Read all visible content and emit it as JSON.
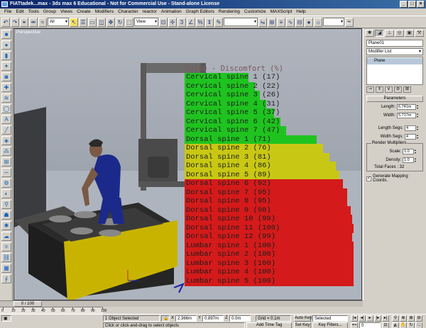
{
  "window": {
    "title": "FIATtadek...max - 3ds max 6 Educational - Not for Commercial Use - Stand-alone License",
    "minimize": "_",
    "maximize": "□",
    "close": "×"
  },
  "menu": [
    "File",
    "Edit",
    "Tools",
    "Group",
    "Views",
    "Create",
    "Modifiers",
    "Character",
    "reactor",
    "Animation",
    "Graph Editors",
    "Rendering",
    "Customize",
    "MAXScript",
    "Help"
  ],
  "toolbar": {
    "selection_filter": "All",
    "ref_coord": "View",
    "named_selection": ""
  },
  "viewport": {
    "label": "Perspective"
  },
  "chart_data": {
    "type": "bar",
    "title": "Spine - Discomfort (%)",
    "categories": [
      "Cervical spine 1",
      "Cervical spine 2",
      "Cervical spine 3",
      "Cervical spine 4",
      "Cervical spine 5",
      "Cervical spine 6",
      "Cervical spine 7",
      "Dorsal spine 1",
      "Dorsal spine 2",
      "Dorsal spine 3",
      "Dorsal spine 4",
      "Dorsal spine 5",
      "Dorsal spine 6",
      "Dorsal spine 7",
      "Dorsal spine 8",
      "Dorsal spine 9",
      "Dorsal spine 10",
      "Dorsal spine 11",
      "Dorsal spine 12",
      "Lumbar spine 1",
      "Lumbar spine 2",
      "Lumbar spine 3",
      "Lumbar spine 4",
      "Lumbar spine 5"
    ],
    "labels": [
      "(17)",
      "(22)",
      "(26)",
      "(31)",
      "(37)",
      "(42)",
      "(47)",
      "(71)",
      "(76)",
      "(81)",
      "(86)",
      "(89)",
      "(92)",
      "(95)",
      "(95)",
      "(98)",
      "(99)",
      "(100)",
      "(99)",
      "(100)",
      "(100)",
      "(100)",
      "(100)",
      "(100)"
    ],
    "values": [
      17,
      22,
      26,
      31,
      37,
      42,
      47,
      71,
      76,
      81,
      86,
      89,
      92,
      95,
      95,
      98,
      99,
      100,
      99,
      100,
      100,
      100,
      100,
      100
    ],
    "colors": {
      "green": "#1fc31f",
      "yellow": "#c8c814",
      "red": "#d41a1a"
    },
    "color_bands": [
      "green",
      "green",
      "green",
      "green",
      "green",
      "green",
      "green",
      "green",
      "yellow",
      "yellow",
      "yellow",
      "yellow",
      "red",
      "red",
      "red",
      "red",
      "red",
      "red",
      "red",
      "red",
      "red",
      "red",
      "red",
      "red"
    ],
    "ylim": [
      0,
      100
    ]
  },
  "command_panel": {
    "object_name": "Plane01",
    "modifier_list": "Modifier List",
    "stack_item": "Plane",
    "rollout": "Parameters",
    "length_label": "Length:",
    "length_val": "6.741m",
    "width_label": "Width:",
    "width_val": "5.717m",
    "length_segs_label": "Length Segs:",
    "length_segs_val": "4",
    "width_segs_label": "Width Segs:",
    "width_segs_val": "4",
    "render_mult_title": "Render Multipliers",
    "scale_label": "Scale:",
    "scale_val": "1.0",
    "density_label": "Density:",
    "density_val": "1.0",
    "total_faces": "Total Faces : 32",
    "gen_mapping": "Generate Mapping Coords."
  },
  "timeline": {
    "slider": "0 / 100",
    "ticks": [
      "0",
      "10",
      "20",
      "30",
      "40",
      "50",
      "60",
      "70",
      "80",
      "90",
      "100"
    ]
  },
  "status": {
    "selected": "1 Object Selected",
    "prompt": "Click or click-and-drag to select objects",
    "x_label": "X",
    "x_val": "2.366m",
    "y_label": "Y",
    "y_val": "0.897m",
    "z_label": "Z",
    "z_val": "0.0m",
    "grid": "Grid = 0.1m",
    "add_time_tag": "Add Time Tag",
    "auto_key": "Auto Key",
    "set_key": "Set Key",
    "key_selected": "Selected",
    "key_filters": "Key Filters...",
    "frame": "0"
  }
}
